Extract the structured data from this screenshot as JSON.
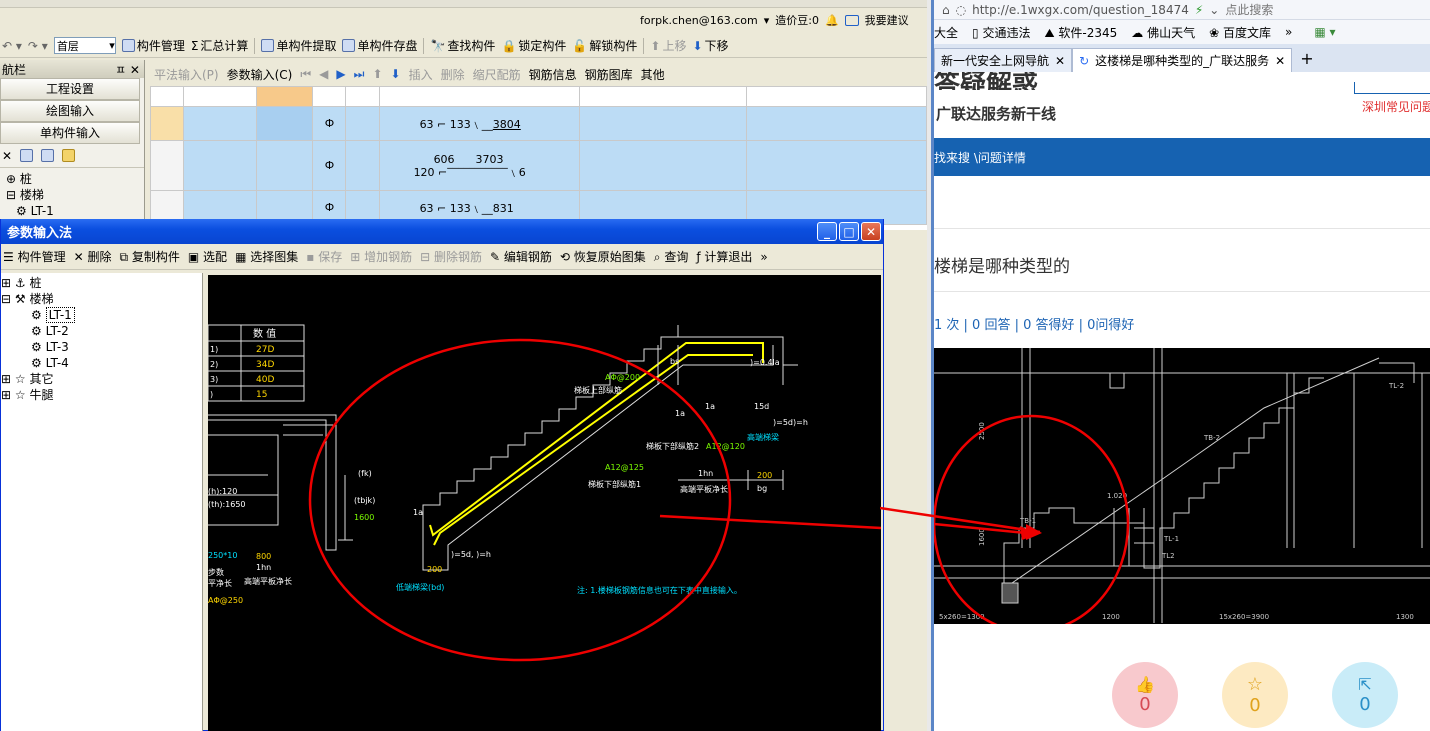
{
  "app": {
    "user_email": "forpk.chen@163.com",
    "price_label": "造价豆:0",
    "suggest_label": "我要建议",
    "floor_select": "首层",
    "toolbar": [
      "构件管理",
      "汇总计算",
      "单构件提取",
      "单构件存盘",
      "查找构件",
      "锁定构件",
      "解锁构件",
      "上移",
      "下移"
    ],
    "nav": {
      "title": "航栏",
      "buttons": [
        "工程设置",
        "绘图输入",
        "单构件输入"
      ],
      "tree": [
        "桩",
        "楼梯",
        "LT-1"
      ]
    },
    "grid_toolbar": {
      "disabled_flat": "平法输入(P)",
      "param_input": "参数输入(C)",
      "insert": "插入",
      "delete": "删除",
      "scale_rebar": "缩尺配筋",
      "rebar_info": "钢筋信息",
      "rebar_lib": "钢筋图库",
      "other": "其他"
    },
    "grid_rows": [
      {
        "grade": "Ф",
        "shape": [
          "63",
          "133",
          "3804"
        ]
      },
      {
        "grade": "Ф",
        "shape": [
          "606",
          "3703",
          "120",
          "6"
        ]
      },
      {
        "grade": "Ф",
        "shape": [
          "63",
          "133",
          "831"
        ]
      }
    ]
  },
  "dialog": {
    "title": "参数输入法",
    "toolbar": [
      "构件管理",
      "删除",
      "复制构件",
      "选配",
      "选择图集",
      "保存",
      "增加钢筋",
      "删除钢筋",
      "编辑钢筋",
      "恢复原始图集",
      "查询",
      "计算退出"
    ],
    "tree": [
      {
        "label": "桩",
        "level": 0
      },
      {
        "label": "楼梯",
        "level": 0
      },
      {
        "label": "LT-1",
        "level": 1
      },
      {
        "label": "LT-2",
        "level": 1
      },
      {
        "label": "LT-3",
        "level": 1
      },
      {
        "label": "LT-4",
        "level": 1
      },
      {
        "label": "其它",
        "level": 0
      },
      {
        "label": "牛腿",
        "level": 0
      }
    ],
    "cad": {
      "table_header": "数 值",
      "table_rows": [
        "27D",
        "34D",
        "40D",
        "15"
      ],
      "left_labels": [
        "(h):120",
        "(th):1650",
        "250*10",
        "800",
        "1hn",
        "步数",
        "平净长",
        "高端平板净长",
        "AΦ@250"
      ],
      "mid_labels": [
        "(fk)",
        "(tbjk)",
        "1600"
      ],
      "stair_labels": {
        "top_rebar": "AΦ@200",
        "top_rebar_name": "梯板上部纵筋",
        "bs": "bs",
        "anchor": ")=0.4la",
        "la1": "1a",
        "la2": "1a",
        "d15": "15d",
        "d5h": ")=5d)=h",
        "high_beam": "高端梯梁",
        "bottom_rebar2": "梯板下部纵筋2",
        "bottom_rebar2_val": "A12@120",
        "bottom_rebar1_val": "A12@125",
        "bottom_rebar1": "梯板下部纵筋1",
        "lhn": "1hn",
        "v200a": "200",
        "high_plate": "高端平板净长",
        "bg": "bg",
        "la3": "1a",
        "d5h2": ")=5d, )=h",
        "v200b": "200",
        "low_beam": "低端梯梁(bd)",
        "note": "注: 1.楼梯板钢筋信息也可在下表中直接输入。"
      }
    }
  },
  "browser": {
    "url": "http://e.1wxgx.com/question_18474",
    "search_placeholder": "点此搜索",
    "bookmarks": [
      "大全",
      "交通违法",
      "软件-2345",
      "佛山天气",
      "百度文库"
    ],
    "tabs": [
      "新一代安全上网导航",
      "这楼梯是哪种类型的_广联达服务"
    ],
    "brand_top": "答疑解惑",
    "brand_sub": "广联达服务新干线",
    "right_link": "深圳常见问题",
    "breadcrumb": "找来搜 \\问题详情",
    "question_title": "楼梯是哪种类型的",
    "stats": "1 次 | 0 回答 | 0 答得好 | 0问得好",
    "actions": [
      {
        "icon": "thumbs-up-icon",
        "count": "0",
        "color": "#f8c9cd"
      },
      {
        "icon": "star-icon",
        "count": "0",
        "color": "#fdeac2"
      },
      {
        "icon": "share-icon",
        "count": "0",
        "color": "#c9ecf8"
      }
    ],
    "drawing": {
      "labels": [
        "TL-2",
        "TB-2",
        "1.020",
        "TB-1",
        "TL-1",
        "TL2",
        "5x260=1300",
        "1200",
        "15x260=3900",
        "1300",
        "1600",
        "2500"
      ]
    }
  }
}
